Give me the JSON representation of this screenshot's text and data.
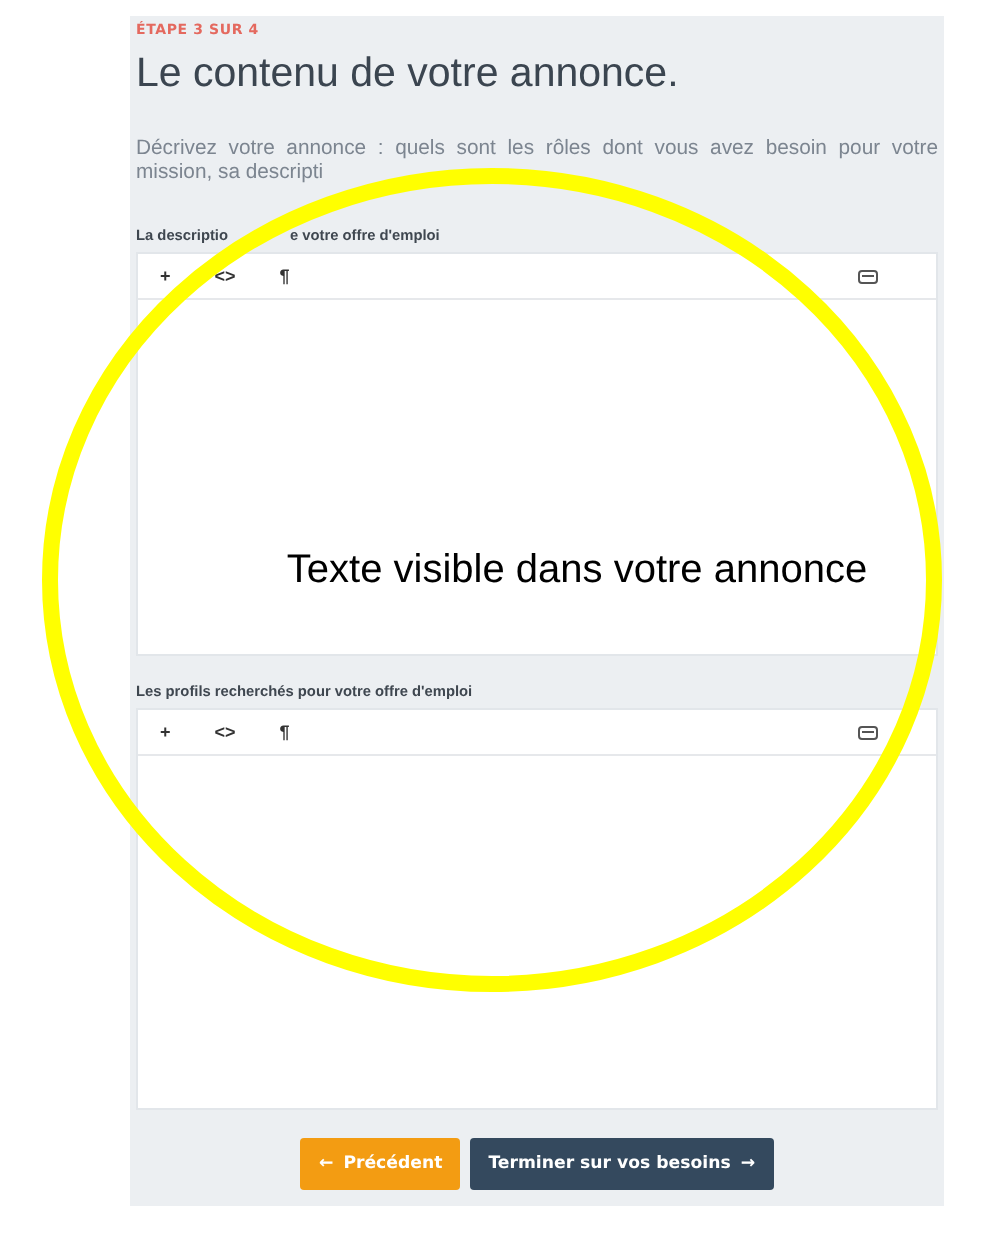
{
  "step": "ÉTAPE 3 SUR 4",
  "title": "Le contenu de votre annonce.",
  "intro": "Décrivez votre annonce : quels sont les rôles dont vous avez besoin pour votre mission, sa descripti",
  "editors": [
    {
      "label": [
        "La descriptio",
        "e votre offre d'emploi"
      ],
      "toolbar": [
        "+",
        "<>",
        "¶"
      ]
    },
    {
      "label": [
        "Les profils recherchés pour votre offre d'emploi"
      ],
      "toolbar": [
        "+",
        "<>",
        "¶"
      ]
    }
  ],
  "buttons": [
    {
      "label": "Précédent",
      "kind": "back",
      "arrow": "←"
    },
    {
      "label": "Terminer sur vos besoins",
      "kind": "next",
      "arrow": "→"
    }
  ],
  "annotation": {
    "text": "Texte visible dans votre annonce"
  }
}
